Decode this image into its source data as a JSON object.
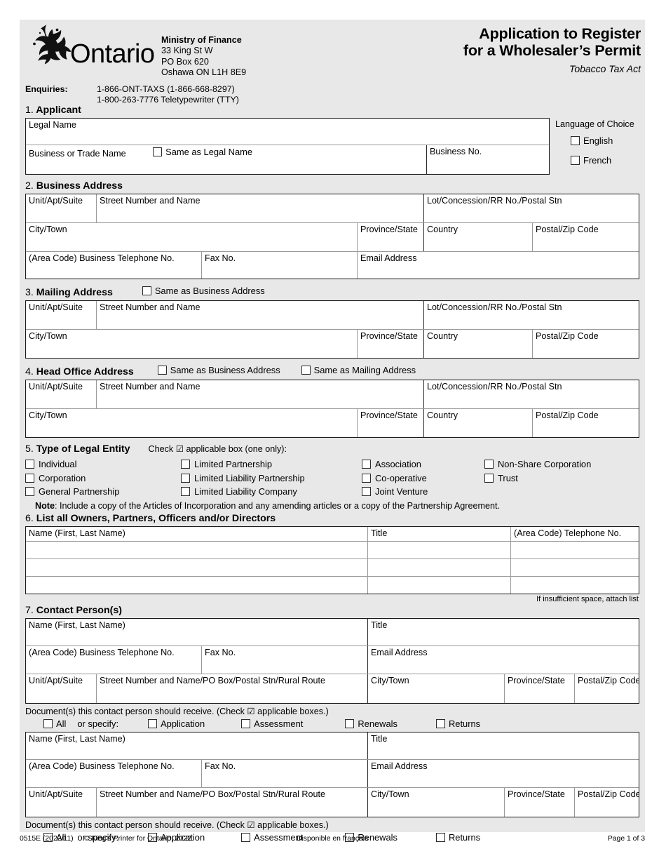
{
  "header": {
    "wordmark": "Ontario",
    "ministry": "Ministry of Finance",
    "address_line1": "33 King St W",
    "address_line2": "PO Box 620",
    "address_line3": "Oshawa ON  L1H 8E9",
    "enquiries_label": "Enquiries:",
    "enquiries_line1": "1-866-ONT-TAXS (1-866-668-8297)",
    "enquiries_line2": "1-800-263-7776 Teletypewriter (TTY)",
    "title_line1": "Application to Register",
    "title_line2": "for a Wholesaler’s Permit",
    "subtitle": "Tobacco Tax Act"
  },
  "section1": {
    "number": "1.",
    "heading": "Applicant",
    "legal_name": "Legal Name",
    "business_trade_name": "Business or Trade Name",
    "same_as_legal_name": "Same as Legal Name",
    "business_no": "Business No.",
    "language_of_choice": "Language of Choice",
    "english": "English",
    "french": "French"
  },
  "section2": {
    "number": "2.",
    "heading": "Business Address",
    "unit": "Unit/Apt/Suite",
    "street": "Street Number and Name",
    "lot": "Lot/Concession/RR No./Postal Stn",
    "city": "City/Town",
    "province": "Province/State",
    "country": "Country",
    "postal": "Postal/Zip Code",
    "telephone": "(Area Code) Business Telephone No.",
    "fax": "Fax No.",
    "email": "Email Address"
  },
  "section3": {
    "number": "3.",
    "heading": "Mailing Address",
    "same_as_business": "Same as Business Address",
    "unit": "Unit/Apt/Suite",
    "street": "Street Number and Name",
    "lot": "Lot/Concession/RR No./Postal Stn",
    "city": "City/Town",
    "province": "Province/State",
    "country": "Country",
    "postal": "Postal/Zip Code"
  },
  "section4": {
    "number": "4.",
    "heading": "Head Office Address",
    "same_as_business": "Same as Business Address",
    "same_as_mailing": "Same as Mailing Address",
    "unit": "Unit/Apt/Suite",
    "street": "Street Number and Name",
    "lot": "Lot/Concession/RR No./Postal Stn",
    "city": "City/Town",
    "province": "Province/State",
    "country": "Country",
    "postal": "Postal/Zip Code"
  },
  "section5": {
    "number": "5.",
    "heading": "Type of Legal Entity",
    "instruction": "Check ☑ applicable box (one only):",
    "options": [
      [
        "Individual",
        "Limited Partnership",
        "Association",
        "Non-Share Corporation"
      ],
      [
        "Corporation",
        "Limited Liability Partnership",
        "Co-operative",
        "Trust"
      ],
      [
        "General Partnership",
        "Limited Liability Company",
        "Joint Venture",
        ""
      ]
    ],
    "note_label": "Note",
    "note_text": ": Include a copy of the Articles of Incorporation and any amending articles or a copy of the Partnership Agreement."
  },
  "section6": {
    "number": "6.",
    "heading": "List all Owners, Partners, Officers and/or Directors",
    "columns": [
      "Name (First, Last Name)",
      "Title",
      "(Area Code) Telephone No."
    ],
    "rows": [
      [
        "",
        "",
        ""
      ],
      [
        "",
        "",
        ""
      ],
      [
        "",
        "",
        ""
      ]
    ],
    "footnote": "If insufficient space, attach list"
  },
  "section7": {
    "number": "7.",
    "heading": "Contact Person(s)",
    "labels": {
      "name": "Name (First, Last Name)",
      "title": "Title",
      "telephone": "(Area Code) Business Telephone No.",
      "fax": "Fax No.",
      "email": "Email Address",
      "unit": "Unit/Apt/Suite",
      "street": "Street Number and Name/PO Box/Postal Stn/Rural Route",
      "city": "City/Town",
      "province": "Province/State",
      "postal": "Postal/Zip Code"
    },
    "documents_line": "Document(s) this contact person should receive. (Check ☑ applicable boxes.)",
    "documents_all": "All",
    "documents_or": "or specify:",
    "documents_options": [
      "Application",
      "Assessment",
      "Renewals",
      "Returns"
    ]
  },
  "footer": {
    "form_no": "0515E (2022/11)",
    "copyright": "© King’s Printer for Ontario, 2022",
    "french": "Disponible en français",
    "page": "Page 1 of 3"
  },
  "colors": {
    "sheet_bg": "#e8e8e8",
    "field_bg": "#ffffff",
    "rule": "#1a1a1a"
  }
}
